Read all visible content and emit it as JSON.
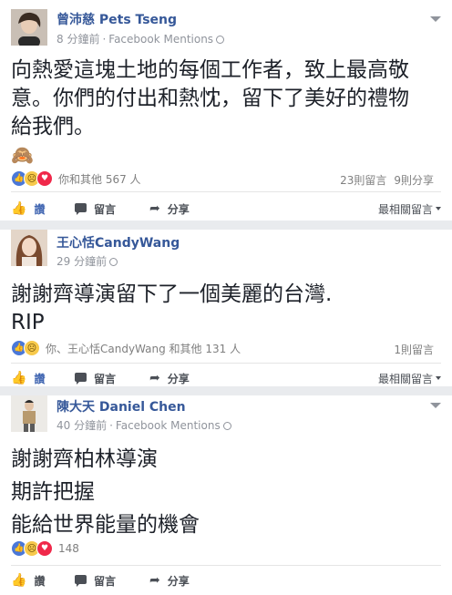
{
  "posts": [
    {
      "author": "曾沛慈 Pets Tseng",
      "time": "8 分鐘前",
      "source": "Facebook Mentions",
      "body_lines": [
        "向熱愛這塊土地的每個工作者，致上最高敬",
        "意。你們的付出和熱忱，留下了美好的禮物",
        "給我們。"
      ],
      "emoji": "🙈",
      "reactions_text": "你和其他 567 人",
      "comments": "23則留言",
      "shares": "9則分享"
    },
    {
      "author": "王心恬CandyWang",
      "time": "29 分鐘前",
      "body_lines": [
        "謝謝齊導演留下了一個美麗的台灣.",
        "RIP"
      ],
      "reactions_text": "你、王心恬CandyWang 和其他 131 人",
      "comments": "1則留言"
    },
    {
      "author": "陳大天 Daniel Chen",
      "time": "40 分鐘前",
      "source": "Facebook Mentions",
      "body_lines": [
        "謝謝齊柏林導演",
        "期許把握",
        "能給世界能量的機會"
      ],
      "reactions_text": "148"
    }
  ],
  "actions": {
    "like": "讚",
    "comment": "留言",
    "share": "分享",
    "sort": "最相關留言"
  },
  "meta_separator": "·",
  "icons": {
    "like": "thumbs-up-icon",
    "comment": "comment-icon",
    "share": "share-arrow-icon",
    "globe": "globe-icon",
    "caret": "chevron-down-icon"
  },
  "colors": {
    "link_blue": "#365899",
    "like_blue": "#4267b2",
    "love_red": "#f0284a",
    "sad_yellow": "#f7c94b",
    "band_gray": "#e9ebee"
  }
}
